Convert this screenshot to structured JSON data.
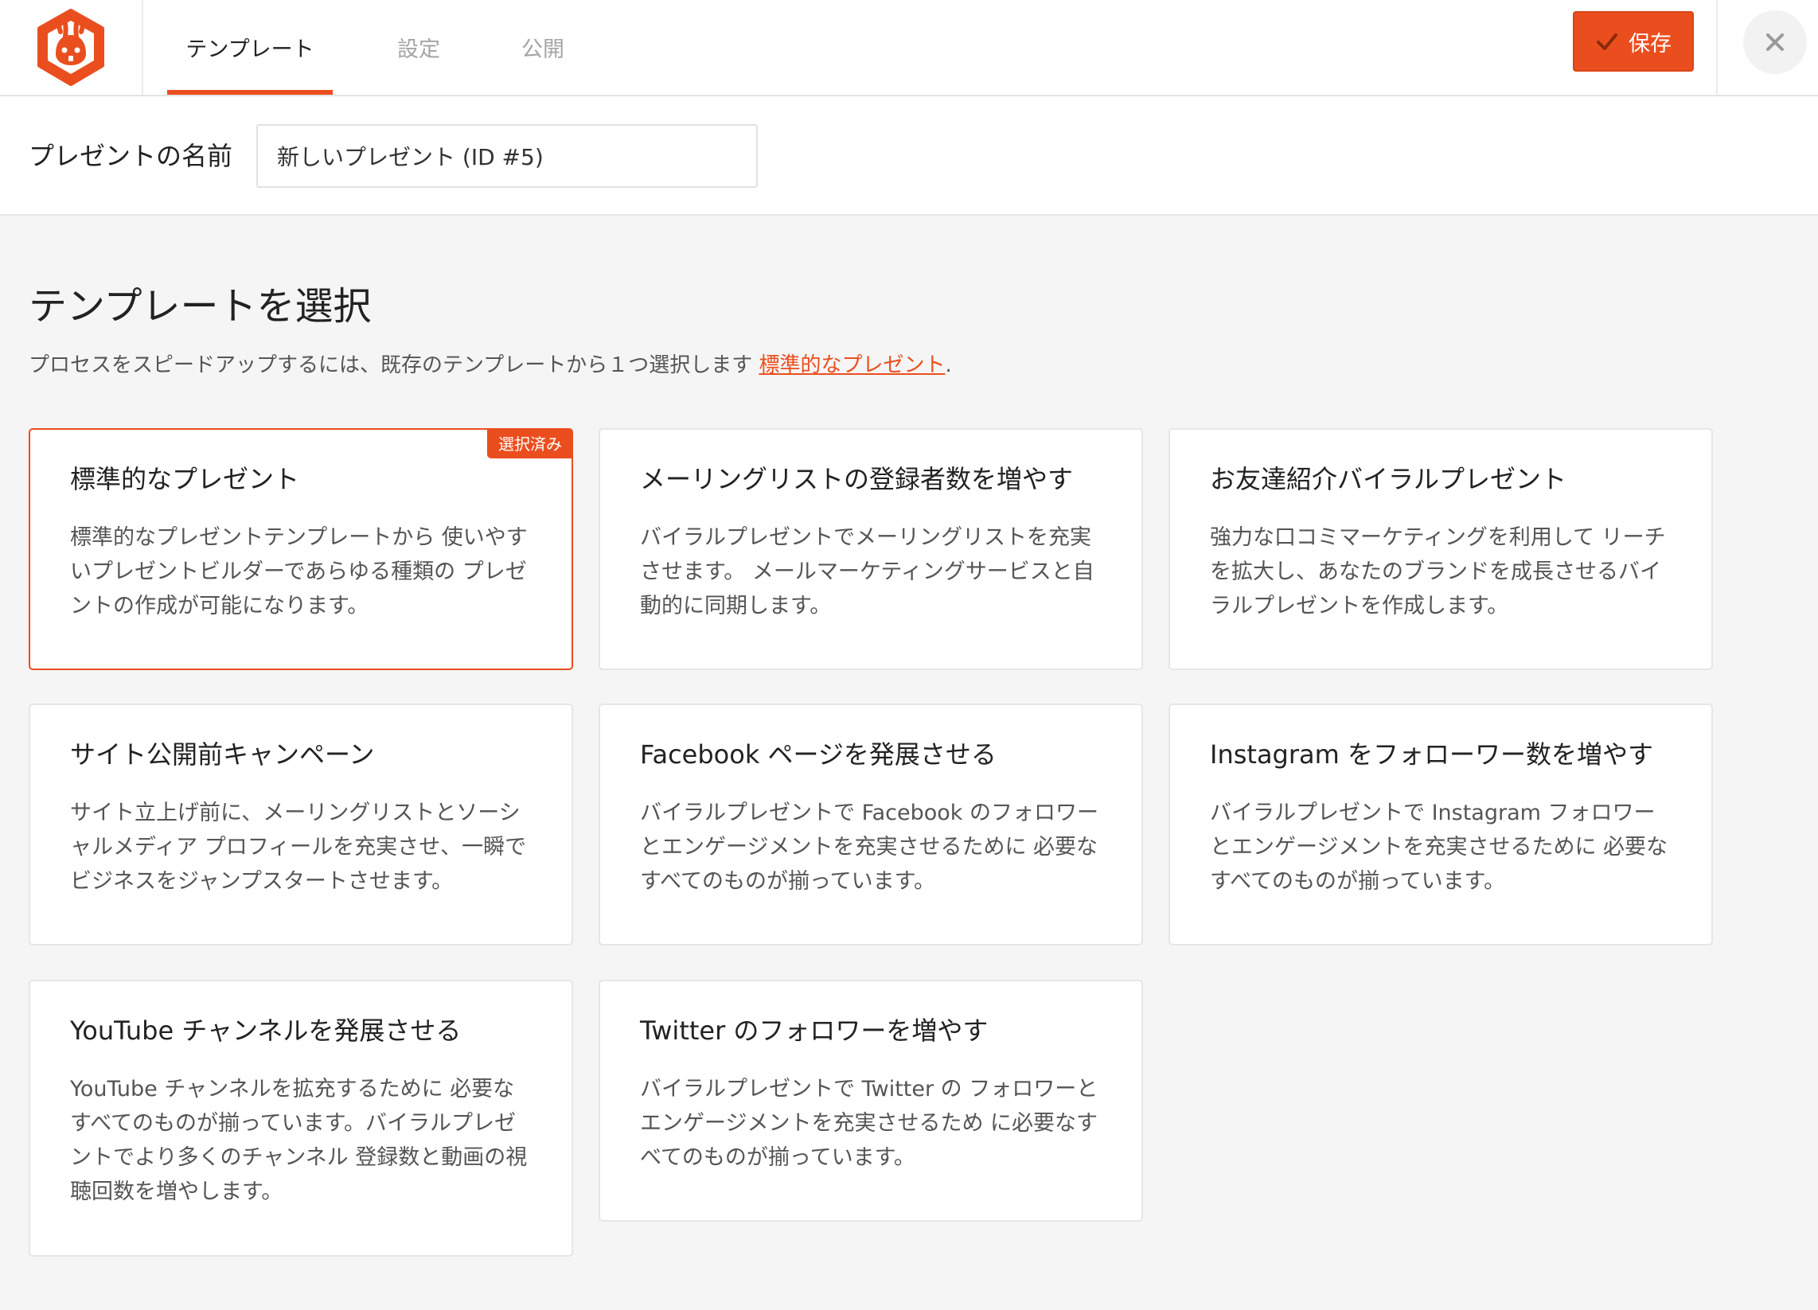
{
  "header": {
    "tabs": [
      {
        "label": "テンプレート",
        "active": true
      },
      {
        "label": "設定",
        "active": false
      },
      {
        "label": "公開",
        "active": false
      }
    ],
    "save_label": "保存"
  },
  "name_field": {
    "label": "プレゼントの名前",
    "value": "新しいプレゼント (ID #5)"
  },
  "section": {
    "title": "テンプレートを選択",
    "description": "プロセスをスピードアップするには、既存のテンプレートから１つ選択します",
    "link_label": "標準的なプレゼント",
    "trailing": "."
  },
  "templates": [
    {
      "title": "標準的なプレゼント",
      "description": "標準的なプレゼントテンプレートから 使いやすいプレゼントビルダーであらゆる種類の プレゼントの作成が可能になります。",
      "badge": "選択済み",
      "selected": true
    },
    {
      "title": "メーリングリストの登録者数を増やす",
      "description": "バイラルプレゼントでメーリングリストを充実させます。 メールマーケティングサービスと自動的に同期します。"
    },
    {
      "title": "お友達紹介バイラルプレゼント",
      "description": "強力な口コミマーケティングを利用して リーチを拡大し、あなたのブランドを成長させるバイラルプレゼントを作成します。"
    },
    {
      "title": "サイト公開前キャンペーン",
      "description": "サイト立上げ前に、メーリングリストとソーシャルメディア プロフィールを充実させ、一瞬で ビジネスをジャンプスタートさせます。"
    },
    {
      "title": "Facebook ページを発展させる",
      "description": "バイラルプレゼントで Facebook のフォロワーとエンゲージメントを充実させるために 必要なすべてのものが揃っています。"
    },
    {
      "title": "Instagram をフォローワー数を増やす",
      "description": "バイラルプレゼントで Instagram フォロワーとエンゲージメントを充実させるために 必要なすべてのものが揃っています。"
    },
    {
      "title": "YouTube チャンネルを発展させる",
      "description": "YouTube チャンネルを拡充するために 必要なすべてのものが揃っています。バイラルプレゼントでより多くのチャンネル 登録数と動画の視聴回数を増やします。"
    },
    {
      "title": "Twitter のフォロワーを増やす",
      "description": "バイラルプレゼントで Twitter の フォロワーとエンゲージメントを充実させるため に必要なすべてのものが揃っています。"
    }
  ],
  "colors": {
    "accent": "#eb4e1e",
    "background": "#f5f5f5",
    "card": "#ffffff"
  },
  "icons": {
    "logo": "rabbit-logo-icon",
    "save": "checkmark-icon",
    "close": "close-icon"
  }
}
